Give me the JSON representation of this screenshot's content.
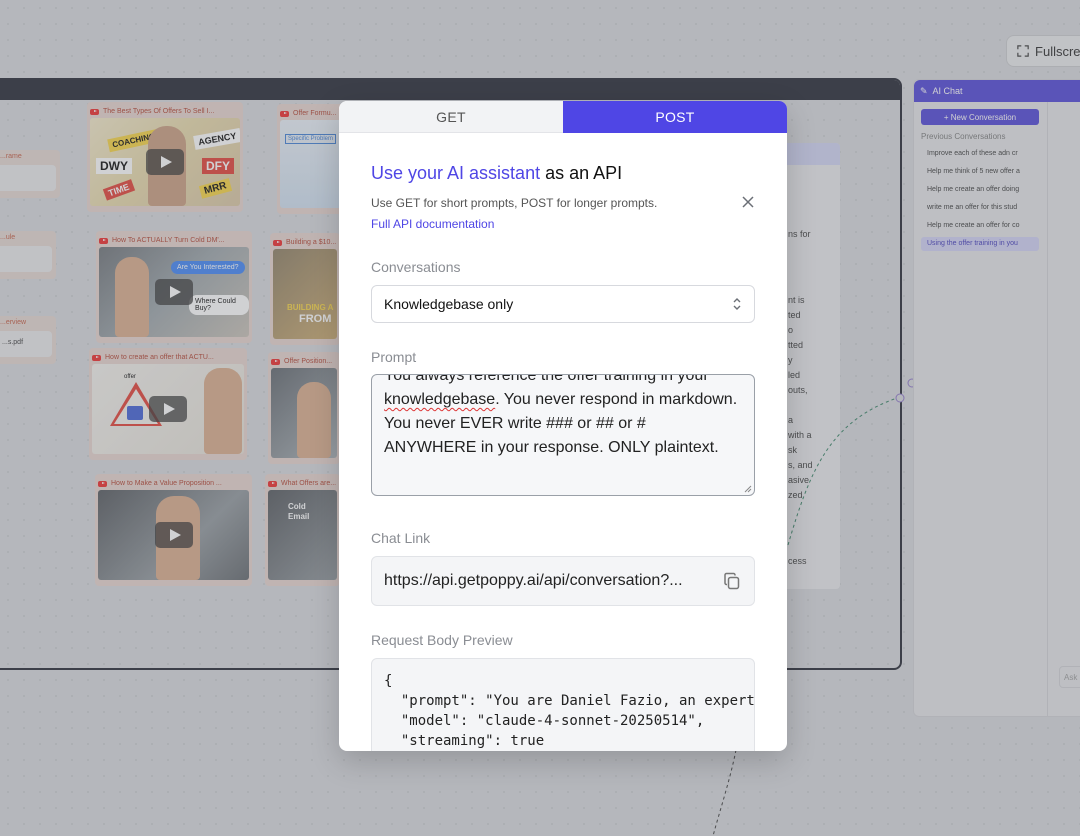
{
  "canvas": {
    "fullscreen_label": "Fullscreen",
    "side_chips": [
      {
        "title": "...rame",
        "body": ""
      },
      {
        "title": "...ule",
        "body": ""
      },
      {
        "title": "...erview",
        "body": "...s.pdf"
      }
    ],
    "video_cards": [
      {
        "title": "The Best Types Of Offers To Sell I...",
        "tags": [
          "COACHING",
          "AGENCY",
          "DWY",
          "DFY",
          "TIME",
          "MRR"
        ]
      },
      {
        "title": "Offer Formu...",
        "tags": [
          "Specific Problem"
        ]
      },
      {
        "title": "How To ACTUALLY Turn Cold DM'...",
        "tags": [
          "Are You Interested?",
          "Where Could Buy?"
        ]
      },
      {
        "title": "Building a $10...",
        "tags": [
          "BUILDING A",
          "FROM"
        ]
      },
      {
        "title": "How to create an offer that ACTU...",
        "tags": [
          "offer"
        ]
      },
      {
        "title": "Offer Position...",
        "tags": []
      },
      {
        "title": "How to Make a Value Proposition ...",
        "tags": []
      },
      {
        "title": "What Offers are...",
        "tags": [
          "Cold",
          "Email"
        ]
      }
    ],
    "doc_lines": [
      "ns for",
      "nt is",
      "ted",
      "o",
      "tted",
      "y",
      "led",
      "outs,",
      "a",
      "with a",
      "sk",
      "s, and",
      "asive",
      "zed",
      "cess"
    ]
  },
  "ai_chat": {
    "title": "AI Chat",
    "new_conversation": "New Conversation",
    "previous_label": "Previous Conversations",
    "conversations": [
      "Improve each of these adn cr",
      "Help me think of 5 new offer a",
      "Help me create an offer doing",
      "write me an offer for this stud",
      "Help me create an offer for co",
      "Using the offer training in you"
    ],
    "input_placeholder": "Ask"
  },
  "modal": {
    "tabs": [
      "GET",
      "POST"
    ],
    "active_tab": "POST",
    "title_highlight": "Use your AI assistant",
    "title_rest": " as an API",
    "subtitle": "Use GET for short prompts, POST for longer prompts.",
    "doc_link": "Full API documentation",
    "conversations_label": "Conversations",
    "conversations_value": "Knowledgebase only",
    "prompt_label": "Prompt",
    "prompt_line1": "You always reference the offer training in your",
    "prompt_spell": "knowledgebase",
    "prompt_rest": ". You never respond in markdown. You never EVER write ### or ## or # ANYWHERE in your response. ONLY plaintext.",
    "chat_link_label": "Chat Link",
    "chat_link": "https://api.getpoppy.ai/api/conversation?...",
    "request_body_label": "Request Body Preview",
    "request_body": "{\n  \"prompt\": \"You are Daniel Fazio, an expert\n  \"model\": \"claude-4-sonnet-20250514\",\n  \"streaming\": true\n}"
  },
  "colors": {
    "accent": "#4f46e5",
    "board_border": "#1c1f2b",
    "chat_header": "#4b3fd6"
  }
}
